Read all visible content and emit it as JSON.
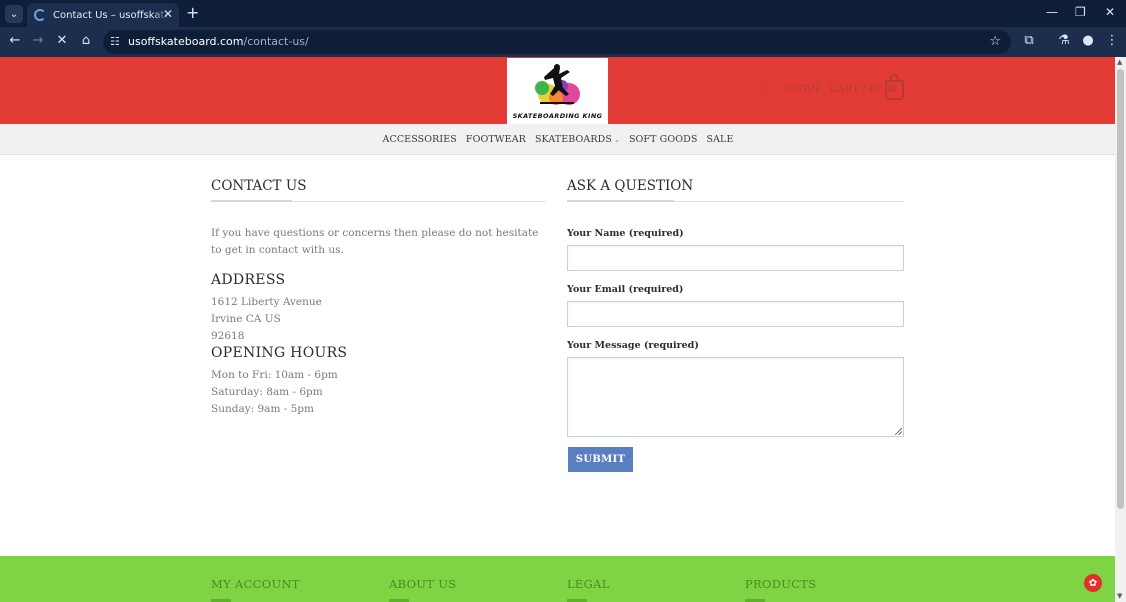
{
  "browser": {
    "tab_title": "Contact Us – usoffskateboard.com",
    "url_domain": "usoffskateboard.com",
    "url_path": "/contact-us/",
    "tab_dropdown_glyph": "⌄",
    "close_glyph": "✕",
    "newtab_glyph": "+",
    "minimize_glyph": "—",
    "maximize_glyph": "❐",
    "back_glyph": "←",
    "forward_glyph": "→",
    "reload_glyph": "✕",
    "home_glyph": "⌂",
    "tune_glyph": "☷",
    "star_glyph": "☆",
    "extensions_glyph": "⧉",
    "labs_glyph": "⚗",
    "profile_glyph": "●",
    "menu_glyph": "⋮"
  },
  "header": {
    "logo_text": "SKATEBOARDING KING",
    "search_glyph": "⌕",
    "login_label": "LOGIN",
    "cart_label": "CART / $0.00",
    "cart_count": "0",
    "accent_color": "#e23b35"
  },
  "nav": {
    "items": [
      "ACCESSORIES",
      "FOOTWEAR",
      "SKATEBOARDS",
      "SOFT GOODS",
      "SALE"
    ],
    "chevron": "⌄"
  },
  "contact": {
    "title": "CONTACT US",
    "intro": "If you have questions or concerns then please do not hesitate to get in contact with us.",
    "address_heading": "ADDRESS",
    "address_lines": [
      "1612 Liberty Avenue",
      "Irvine CA US",
      "92618"
    ],
    "hours_heading": "OPENING HOURS",
    "hours_lines": [
      "Mon to Fri: 10am - 6pm",
      "Saturday: 8am - 6pm",
      "Sunday: 9am - 5pm"
    ]
  },
  "form": {
    "title": "ASK A QUESTION",
    "name_label": "Your Name (required)",
    "email_label": "Your Email (required)",
    "message_label": "Your Message (required)",
    "submit_label": "SUBMIT",
    "button_color": "#5a7fbf"
  },
  "footer": {
    "headings": [
      "MY ACCOUNT",
      "ABOUT US",
      "LEGAL",
      "PRODUCTS"
    ],
    "color": "#7ed443",
    "badge_glyph": "✿"
  }
}
